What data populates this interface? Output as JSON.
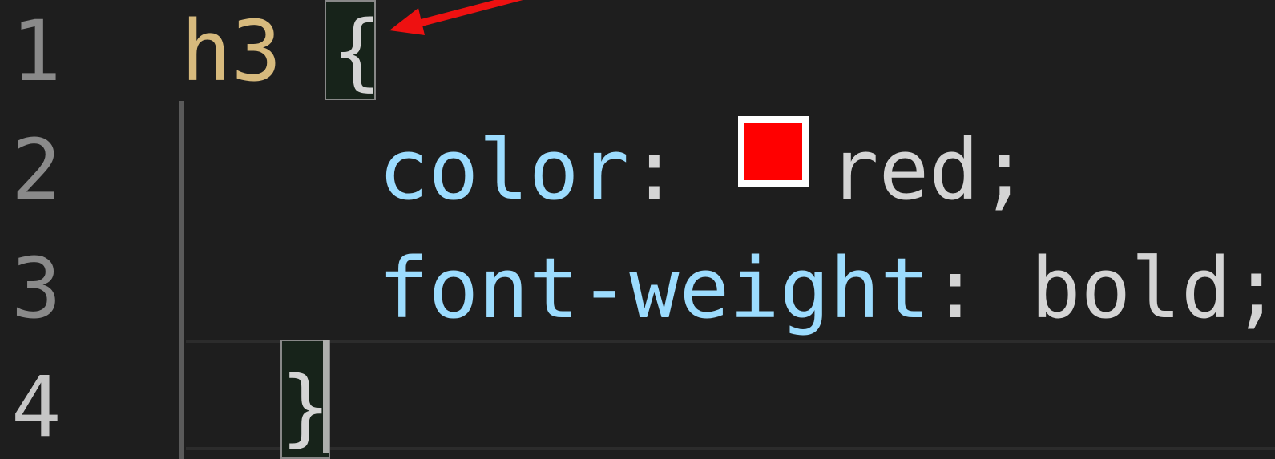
{
  "gutter": {
    "lines": [
      "1",
      "2",
      "3",
      "4"
    ]
  },
  "code": {
    "line1": {
      "selector": "h3",
      "space": " ",
      "open_brace": "{"
    },
    "line2": {
      "property": "color",
      "colon": ":",
      "value": "red",
      "semicolon": ";"
    },
    "line3": {
      "property": "font-weight",
      "colon": ":",
      "value": "bold",
      "semicolon": ";"
    },
    "line4": {
      "close_brace": "}"
    }
  },
  "colors": {
    "background": "#1e1e1e",
    "selector": "#d7ba7d",
    "property": "#9cdcfe",
    "value": "#d4d4d4",
    "line_number": "#8a8a8a",
    "swatch": "#ff0000",
    "annotation_arrow": "#ee1111"
  },
  "icons": {
    "color_swatch": "color-swatch-icon",
    "annotation": "arrow-annotation-icon"
  }
}
